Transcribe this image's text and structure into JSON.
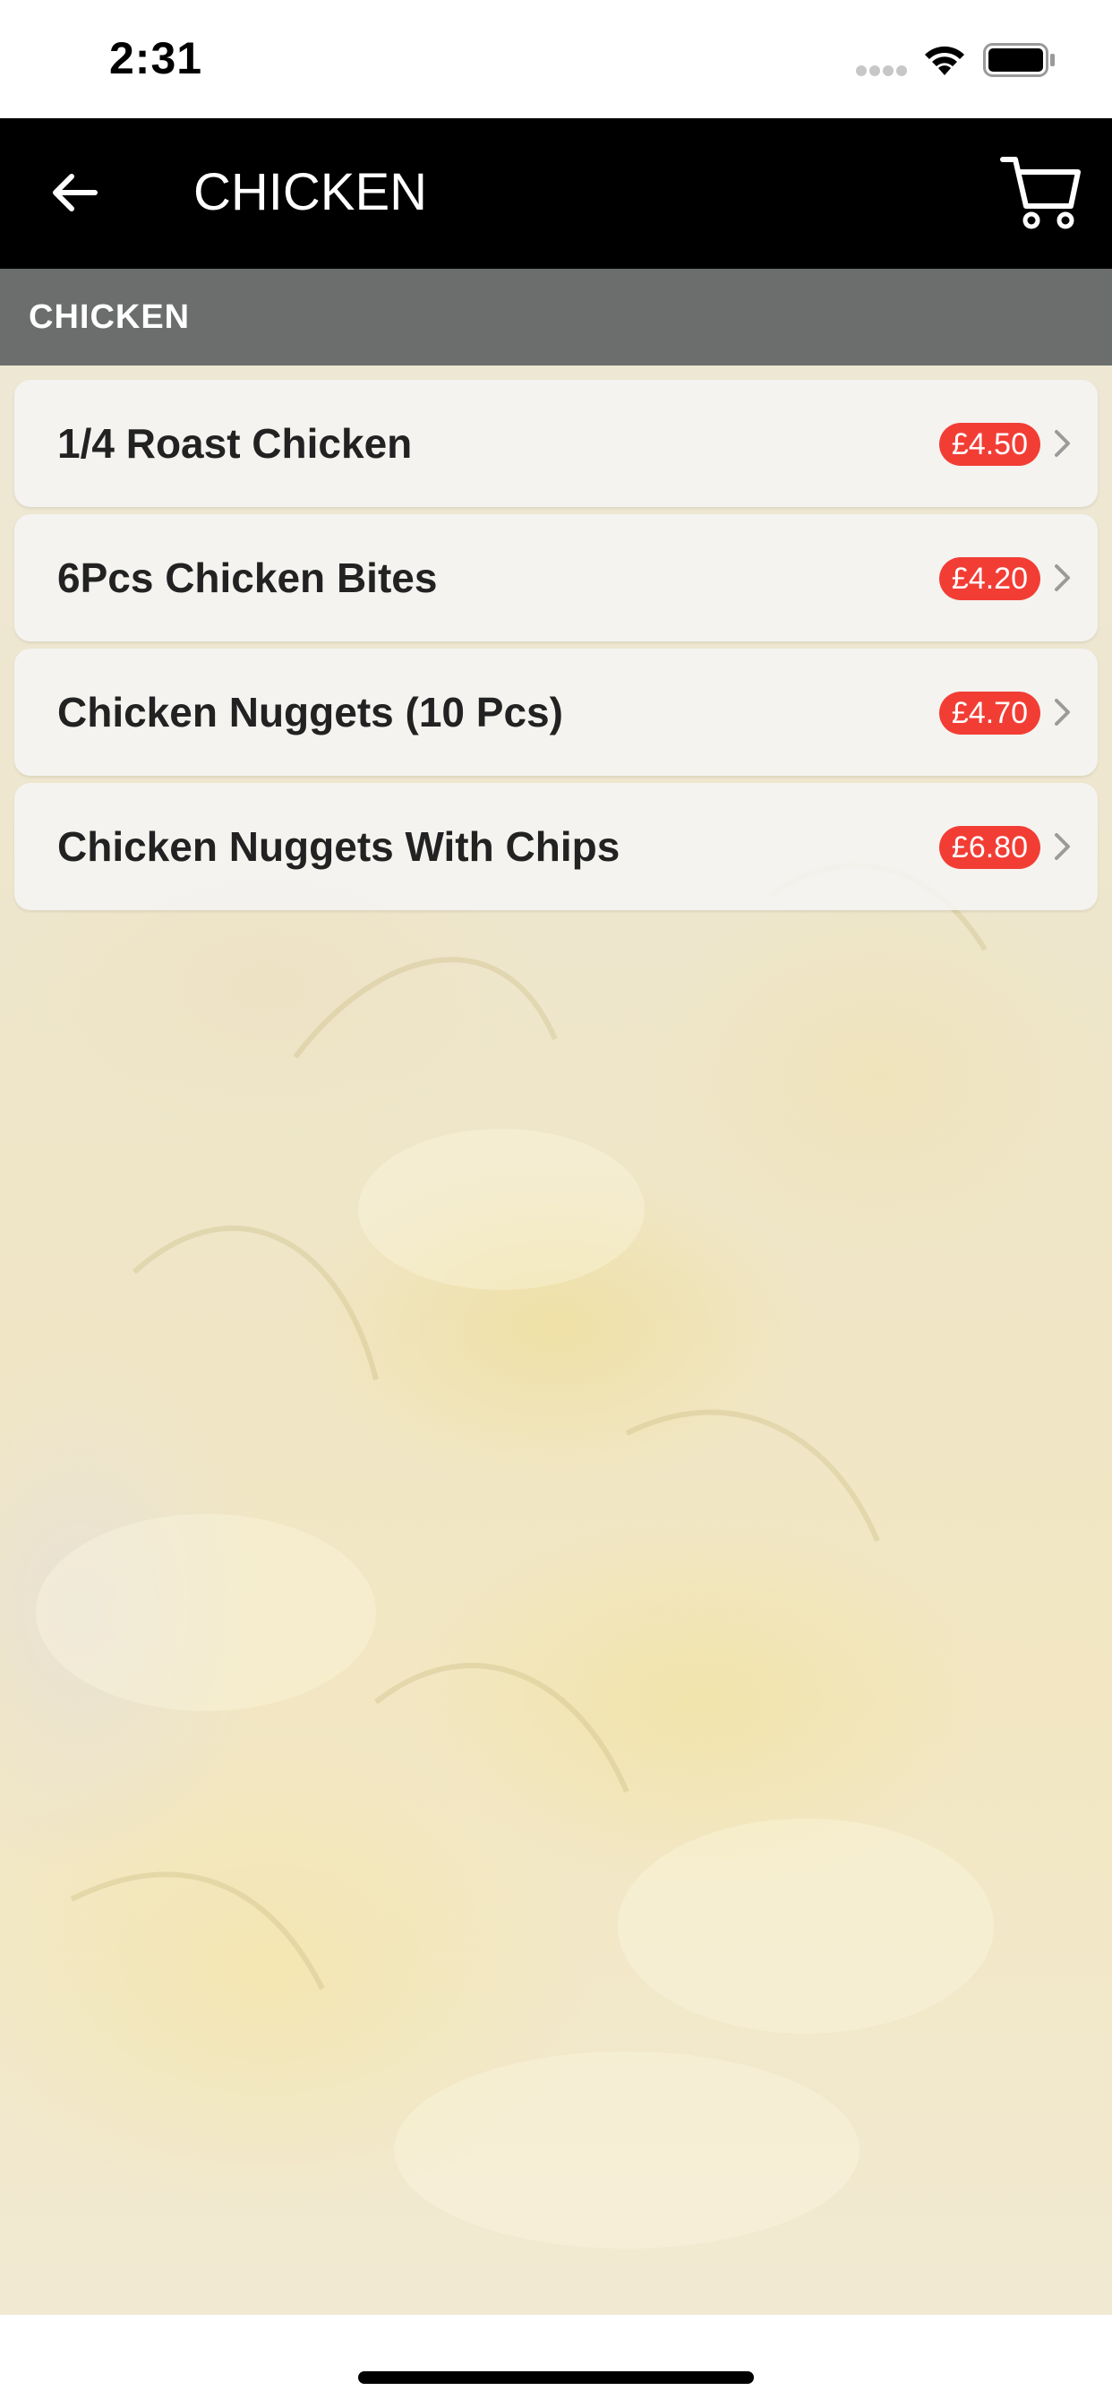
{
  "status_bar": {
    "time": "2:31",
    "signal_icon": "cellular-signal-dots-icon",
    "wifi_icon": "wifi-icon",
    "battery_icon": "battery-full-icon"
  },
  "nav": {
    "title": "CHICKEN",
    "back_icon": "arrow-left-icon",
    "cart_icon": "shopping-cart-icon"
  },
  "section": {
    "label": "CHICKEN"
  },
  "menu_items": [
    {
      "name": "1/4 Roast Chicken",
      "price": "£4.50"
    },
    {
      "name": "6Pcs Chicken Bites",
      "price": "£4.20"
    },
    {
      "name": "Chicken Nuggets (10 Pcs)",
      "price": "£4.70"
    },
    {
      "name": "Chicken Nuggets With Chips",
      "price": "£6.80"
    }
  ],
  "colors": {
    "nav_background": "#000000",
    "price_badge": "#f23d35",
    "section_header": "#464c50"
  }
}
